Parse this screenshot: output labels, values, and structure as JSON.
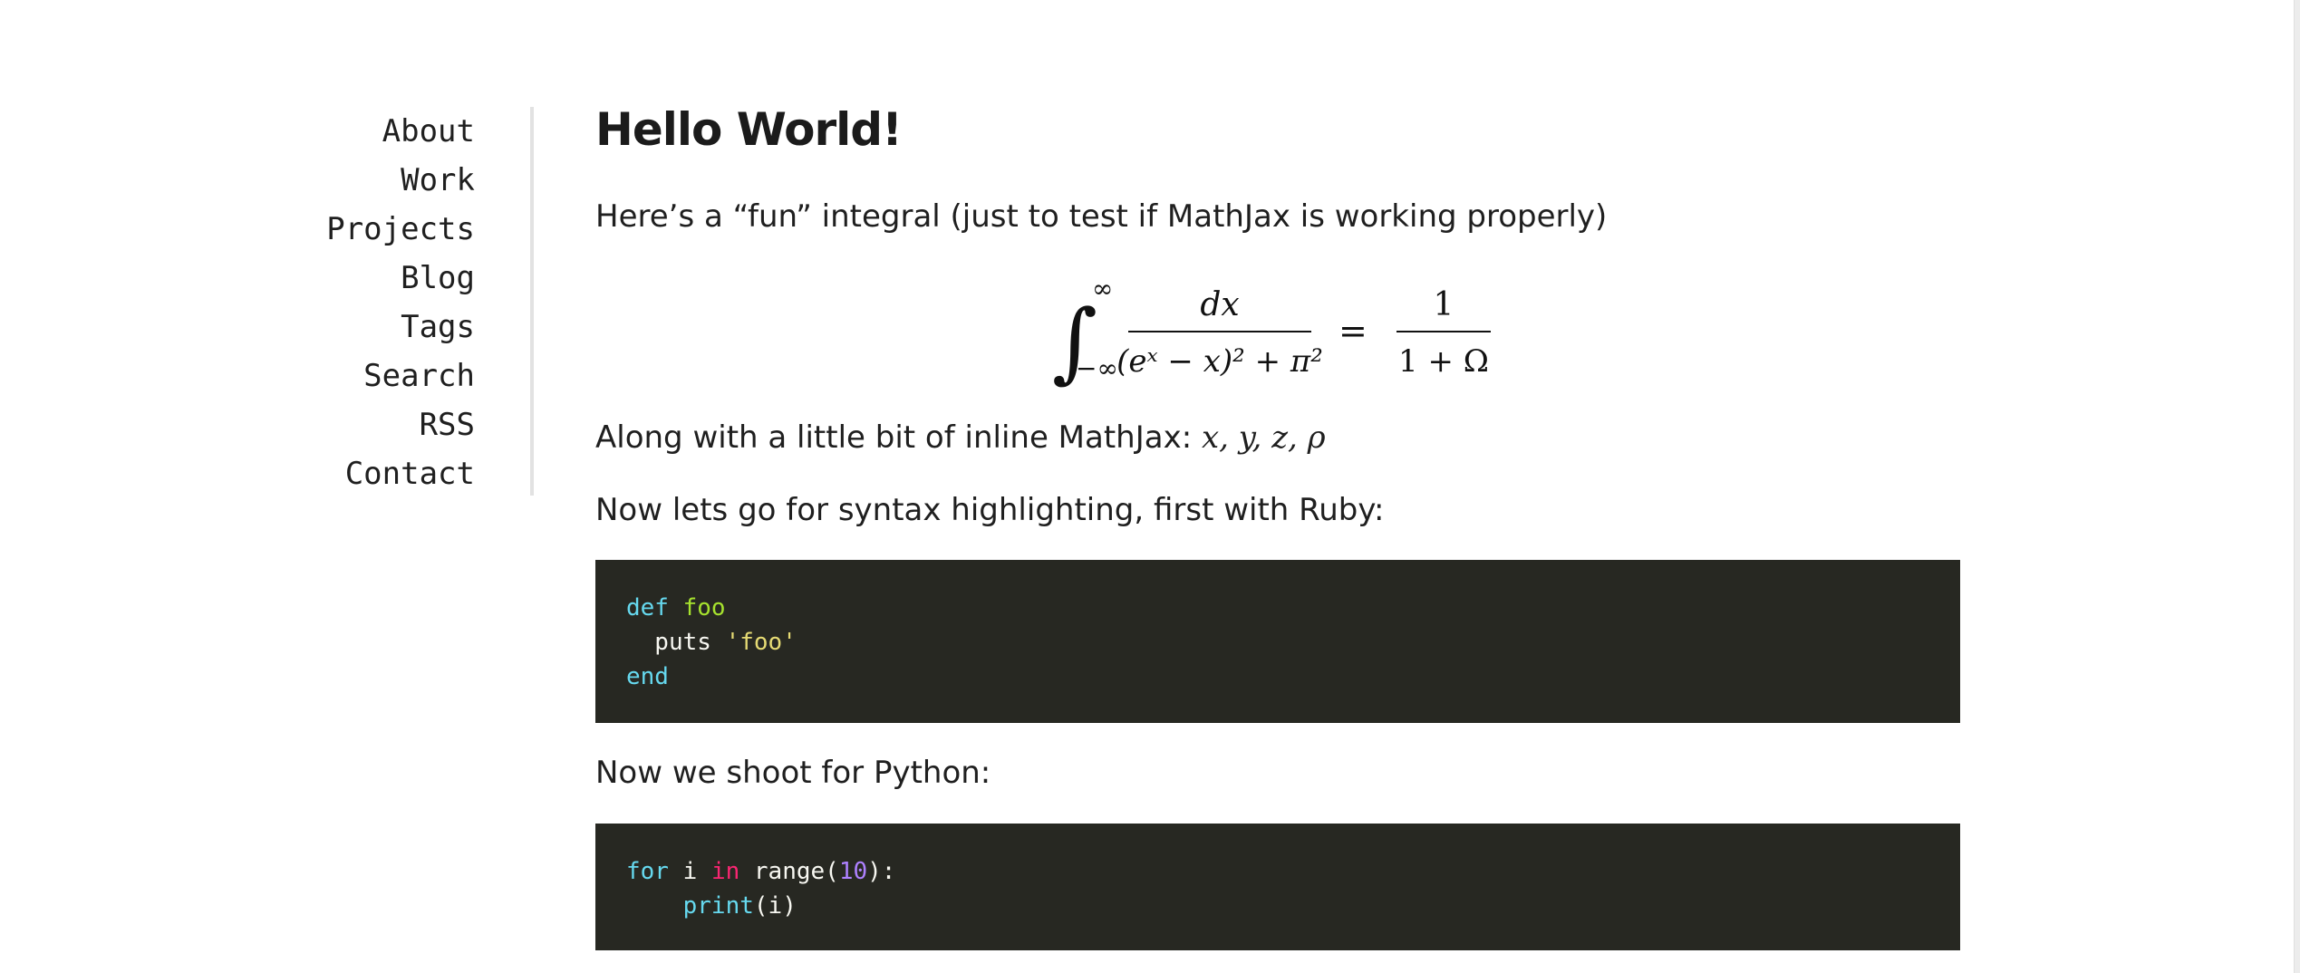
{
  "nav": {
    "items": [
      {
        "label": "About"
      },
      {
        "label": "Work"
      },
      {
        "label": "Projects"
      },
      {
        "label": "Blog"
      },
      {
        "label": "Tags"
      },
      {
        "label": "Search"
      },
      {
        "label": "RSS"
      },
      {
        "label": "Contact"
      }
    ]
  },
  "post": {
    "title": "Hello World!",
    "intro": "Here’s a “fun” integral (just to test if MathJax is working properly)",
    "equation": {
      "lower_limit": "−∞",
      "upper_limit": "∞",
      "numerator": "dx",
      "denominator": "(eˣ − x)² + π²",
      "rhs_numerator": "1",
      "rhs_denominator": "1 + Ω"
    },
    "inline_text": "Along with a little bit of inline MathJax: ",
    "inline_math": "x, y, z, ρ",
    "ruby_intro": "Now lets go for syntax highlighting, first with Ruby:",
    "python_intro": "Now we shoot for Python:"
  },
  "code": {
    "ruby": {
      "line1_kw": "def",
      "line1_fn": "foo",
      "line2_text": "  puts ",
      "line2_str": "'foo'",
      "line3_kw": "end"
    },
    "python": {
      "line1_kw": "for",
      "line1_var": " i ",
      "line1_op": "in",
      "line1_fn": " range(",
      "line1_num": "10",
      "line1_end": "):",
      "line2_indent": "    ",
      "line2_kw": "print",
      "line2_rest": "(i)"
    }
  },
  "colors": {
    "code_background": "#272822",
    "keyword": "#66d9ef",
    "function": "#a6e22e",
    "string": "#e6db74",
    "operator": "#f92672",
    "number": "#ae81ff"
  }
}
